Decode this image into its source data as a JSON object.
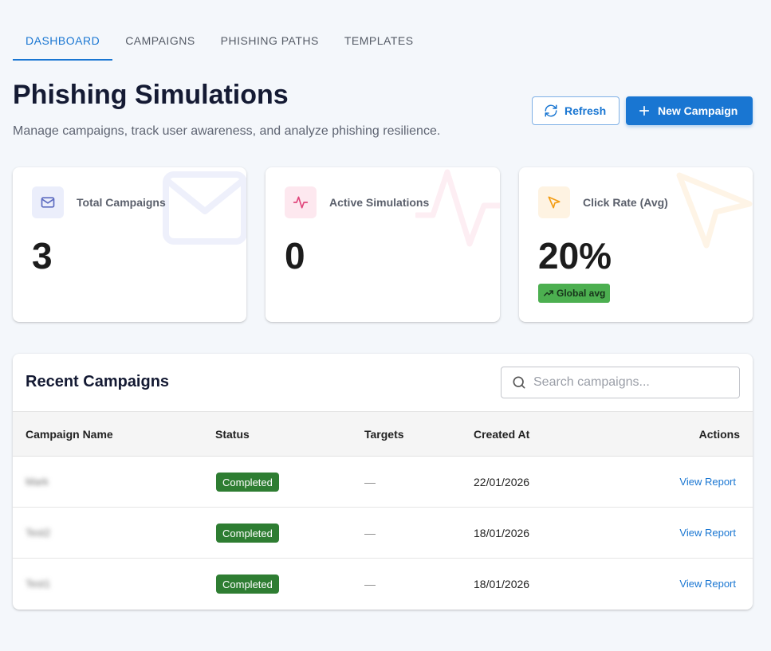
{
  "tabs": [
    {
      "label": "DASHBOARD",
      "active": true
    },
    {
      "label": "CAMPAIGNS",
      "active": false
    },
    {
      "label": "PHISHING PATHS",
      "active": false
    },
    {
      "label": "TEMPLATES",
      "active": false
    }
  ],
  "header": {
    "title": "Phishing Simulations",
    "subtitle": "Manage campaigns, track user awareness, and analyze phishing resilience.",
    "refresh_label": "Refresh",
    "new_campaign_label": "New Campaign"
  },
  "stats": [
    {
      "label": "Total Campaigns",
      "value": "3",
      "icon": "mail-icon",
      "color": "#5c6bc0",
      "bg": "#ebeefb"
    },
    {
      "label": "Active Simulations",
      "value": "0",
      "icon": "activity-icon",
      "color": "#e0457b",
      "bg": "#fde8ef"
    },
    {
      "label": "Click Rate (Avg)",
      "value": "20%",
      "icon": "cursor-icon",
      "color": "#f39c12",
      "bg": "#fef3e2",
      "badge": "Global avg"
    }
  ],
  "recent": {
    "title": "Recent Campaigns",
    "search_placeholder": "Search campaigns...",
    "columns": {
      "name": "Campaign Name",
      "status": "Status",
      "targets": "Targets",
      "created": "Created At",
      "actions": "Actions"
    },
    "rows": [
      {
        "name": "Mark",
        "status": "Completed",
        "targets": "—",
        "created": "22/01/2026",
        "action": "View Report"
      },
      {
        "name": "Test2",
        "status": "Completed",
        "targets": "—",
        "created": "18/01/2026",
        "action": "View Report"
      },
      {
        "name": "Test1",
        "status": "Completed",
        "targets": "—",
        "created": "18/01/2026",
        "action": "View Report"
      }
    ]
  },
  "colors": {
    "primary": "#1976d2",
    "success": "#2e7d32",
    "badge_green": "#4caf50"
  }
}
